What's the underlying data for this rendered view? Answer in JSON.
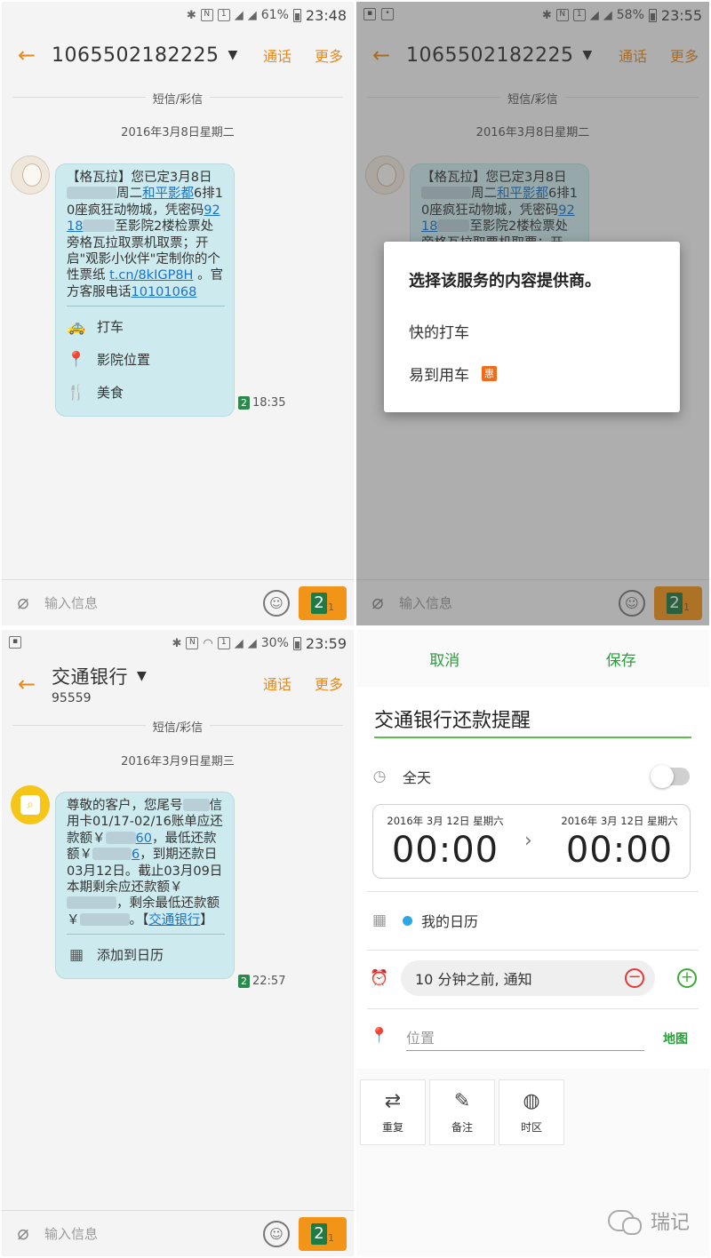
{
  "p1": {
    "status": {
      "battery": "61%",
      "time": "23:48"
    },
    "contact": "1065502182225",
    "actions": {
      "call": "通话",
      "more": "更多"
    },
    "section": "短信/彩信",
    "date": "2016年3月8日星期二",
    "msg": {
      "t1": "【格瓦拉】您已定3月8日",
      "t2": "周二",
      "l1": "和平影都",
      "t3": "6排10座疯狂动物城，凭密码",
      "l2": "9218",
      "t4": "至影院2楼检票处旁格瓦拉取票机取票；开启\"观影小伙伴\"定制你的个性票纸 ",
      "l3": "t.cn/8kIGP8H",
      "t5": " 。官方客服电话",
      "l4": "10101068"
    },
    "services": [
      {
        "icon": "taxi-icon",
        "label": "打车"
      },
      {
        "icon": "location-pin-icon",
        "label": "影院位置"
      },
      {
        "icon": "fork-knife-icon",
        "label": "美食"
      }
    ],
    "sim": "2",
    "msg_time": "18:35",
    "input_placeholder": "输入信息",
    "send": {
      "n2": "2",
      "n1": "1"
    }
  },
  "p2": {
    "status": {
      "battery": "58%",
      "time": "23:55"
    },
    "contact": "1065502182225",
    "actions": {
      "call": "通话",
      "more": "更多"
    },
    "section": "短信/彩信",
    "date": "2016年3月8日星期二",
    "msg": {
      "t1": "【格瓦拉】您已定3月8日",
      "t2": "周二",
      "l1": "和平影都",
      "t3": "6排10座疯狂动物城，凭密码",
      "l2": "9218",
      "t4": "至影院2楼检票处旁格瓦拉取票机取票；开"
    },
    "dialog": {
      "title": "选择该服务的内容提供商。",
      "options": [
        {
          "label": "快的打车"
        },
        {
          "label": "易到用车",
          "badge": "惠"
        }
      ]
    },
    "input_placeholder": "输入信息",
    "send": {
      "n2": "2",
      "n1": "1"
    }
  },
  "p3": {
    "status": {
      "battery": "30%",
      "time": "23:59"
    },
    "contact": "交通银行",
    "contact_sub": "95559",
    "actions": {
      "call": "通话",
      "more": "更多"
    },
    "section": "短信/彩信",
    "date": "2016年3月9日星期三",
    "msg": {
      "t1": "尊敬的客户，您尾号",
      "t2": "信用卡01/17-02/16账单应还款额￥",
      "l1": "60",
      "t3": "，最低还款额￥",
      "l2": "6",
      "t4": "，到期还款日03月12日。截止03月09日本期剩余应还款额￥",
      "t5": "，剩余最低还款额￥",
      "t6": "。【",
      "l3": "交通银行",
      "t7": "】"
    },
    "services": [
      {
        "icon": "calendar-icon",
        "label": "添加到日历"
      }
    ],
    "sim": "2",
    "msg_time": "22:57",
    "input_placeholder": "输入信息",
    "send": {
      "n2": "2",
      "n1": "1"
    }
  },
  "p4": {
    "cancel": "取消",
    "save": "保存",
    "title": "交通银行还款提醒",
    "all_day": "全天",
    "start": {
      "date": "2016年 3月 12日 星期六",
      "time": "00:00"
    },
    "end": {
      "date": "2016年 3月 12日 星期六",
      "time": "00:00"
    },
    "calendar": "我的日历",
    "reminder": "10 分钟之前, 通知",
    "location_placeholder": "位置",
    "map": "地图",
    "tiles": [
      {
        "icon": "repeat-icon",
        "label": "重复"
      },
      {
        "icon": "note-icon",
        "label": "备注"
      },
      {
        "icon": "timezone-icon",
        "label": "时区"
      }
    ],
    "watermark": "瑞记"
  }
}
